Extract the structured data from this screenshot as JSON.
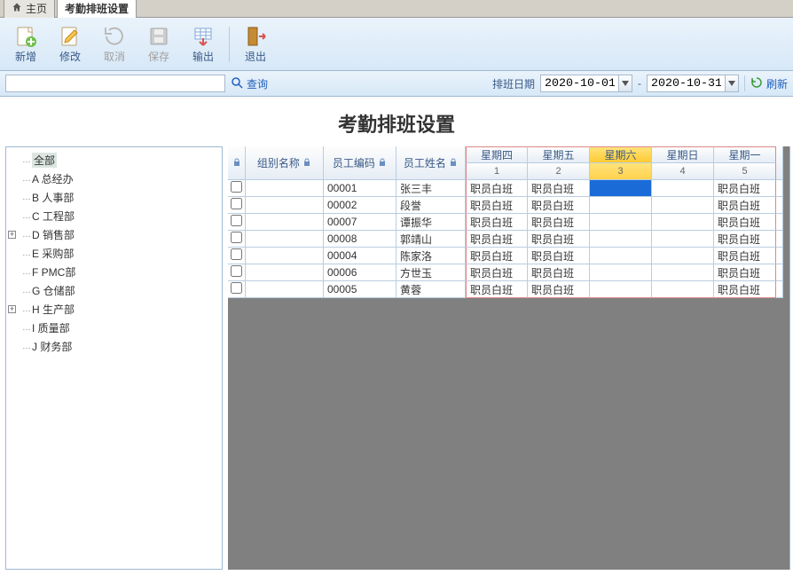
{
  "tabs": {
    "home": "主页",
    "current": "考勤排班设置"
  },
  "toolbar": {
    "new": "新增",
    "edit": "修改",
    "cancel": "取消",
    "save": "保存",
    "export": "输出",
    "exit": "退出"
  },
  "filter": {
    "search_placeholder": "",
    "query": "查询",
    "date_label": "排班日期",
    "date_from": "2020-10-01",
    "date_to": "2020-10-31",
    "to_sep": "-",
    "refresh": "刷新"
  },
  "title": "考勤排班设置",
  "tree": [
    {
      "label": "全部",
      "prefix": "",
      "expander": "",
      "selected": true
    },
    {
      "label": "A 总经办",
      "prefix": "",
      "expander": ""
    },
    {
      "label": "B 人事部",
      "prefix": "",
      "expander": ""
    },
    {
      "label": "C 工程部",
      "prefix": "",
      "expander": ""
    },
    {
      "label": "D 销售部",
      "prefix": "+",
      "expander": "+"
    },
    {
      "label": "E 采购部",
      "prefix": "",
      "expander": ""
    },
    {
      "label": "F PMC部",
      "prefix": "",
      "expander": ""
    },
    {
      "label": "G 仓储部",
      "prefix": "",
      "expander": ""
    },
    {
      "label": "H 生产部",
      "prefix": "+",
      "expander": "+"
    },
    {
      "label": "I 质量部",
      "prefix": "",
      "expander": ""
    },
    {
      "label": "J 财务部",
      "prefix": "",
      "expander": ""
    }
  ],
  "grid": {
    "headers": {
      "group": "组别名称",
      "empcode": "员工编码",
      "empname": "员工姓名",
      "days": [
        {
          "weekday": "星期四",
          "num": "1"
        },
        {
          "weekday": "星期五",
          "num": "2"
        },
        {
          "weekday": "星期六",
          "num": "3",
          "isSat": true
        },
        {
          "weekday": "星期日",
          "num": "4"
        },
        {
          "weekday": "星期一",
          "num": "5"
        }
      ]
    },
    "shift": "职员白班",
    "rows": [
      {
        "code": "00001",
        "name": "张三丰",
        "d1": "职员白班",
        "d2": "职员白班",
        "d3": "",
        "d4": "",
        "d5": "职员白班",
        "selected": true
      },
      {
        "code": "00002",
        "name": "段誉",
        "d1": "职员白班",
        "d2": "职员白班",
        "d3": "",
        "d4": "",
        "d5": "职员白班"
      },
      {
        "code": "00007",
        "name": "谭振华",
        "d1": "职员白班",
        "d2": "职员白班",
        "d3": "",
        "d4": "",
        "d5": "职员白班"
      },
      {
        "code": "00008",
        "name": "郭靖山",
        "d1": "职员白班",
        "d2": "职员白班",
        "d3": "",
        "d4": "",
        "d5": "职员白班"
      },
      {
        "code": "00004",
        "name": "陈家洛",
        "d1": "职员白班",
        "d2": "职员白班",
        "d3": "",
        "d4": "",
        "d5": "职员白班"
      },
      {
        "code": "00006",
        "name": "方世玉",
        "d1": "职员白班",
        "d2": "职员白班",
        "d3": "",
        "d4": "",
        "d5": "职员白班"
      },
      {
        "code": "00005",
        "name": "黄蓉",
        "d1": "职员白班",
        "d2": "职员白班",
        "d3": "",
        "d4": "",
        "d5": "职员白班"
      }
    ]
  }
}
